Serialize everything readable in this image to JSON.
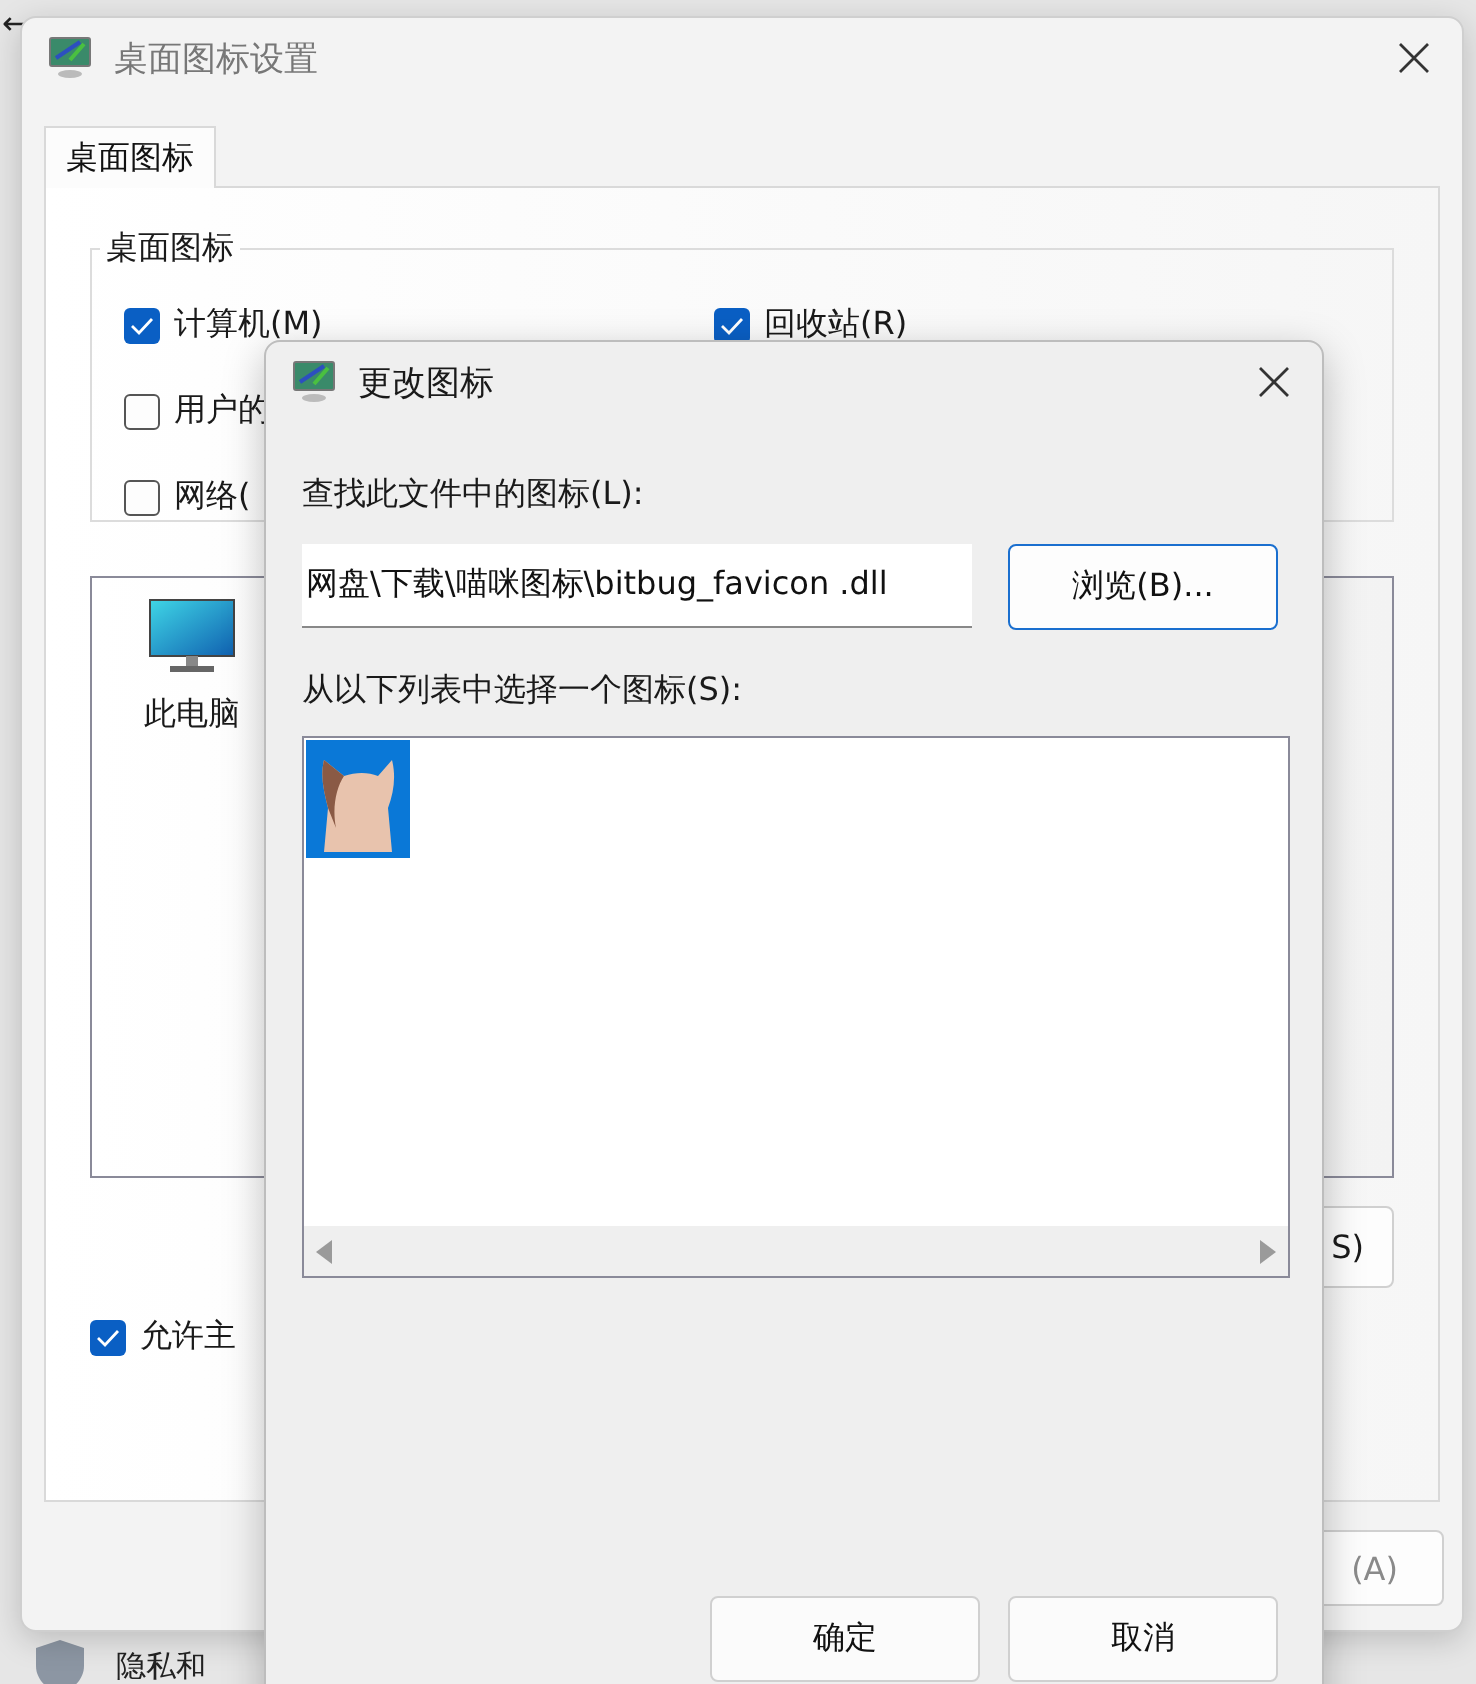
{
  "background": {
    "back_glyph": "←",
    "footer_item": "隐私和"
  },
  "back_window": {
    "title": "桌面图标设置",
    "tabs": [
      {
        "label": "桌面图标",
        "selected": true
      }
    ],
    "group": {
      "title": "桌面图标",
      "rows": [
        [
          {
            "label": "计算机(M)",
            "checked": true
          },
          {
            "label": "回收站(R)",
            "checked": true
          }
        ],
        [
          {
            "label": "用户的",
            "checked": false
          }
        ],
        [
          {
            "label": "网络(",
            "checked": false
          }
        ]
      ]
    },
    "icons": [
      {
        "label": "此电脑",
        "selected": false
      }
    ],
    "restore_button": "S)",
    "theme_checkbox": {
      "label": "允许主",
      "checked": true
    },
    "apply_button": {
      "label": "(A)",
      "disabled": true
    }
  },
  "dialog": {
    "title": "更改图标",
    "file_label": "查找此文件中的图标(L):",
    "file_value": "网盘\\下载\\喵咪图标\\bitbug_favicon .dll",
    "browse_button": "浏览(B)...",
    "list_label": "从以下列表中选择一个图标(S):",
    "icons": [
      {
        "selected": true
      }
    ],
    "buttons": [
      "确定",
      "取消"
    ]
  }
}
